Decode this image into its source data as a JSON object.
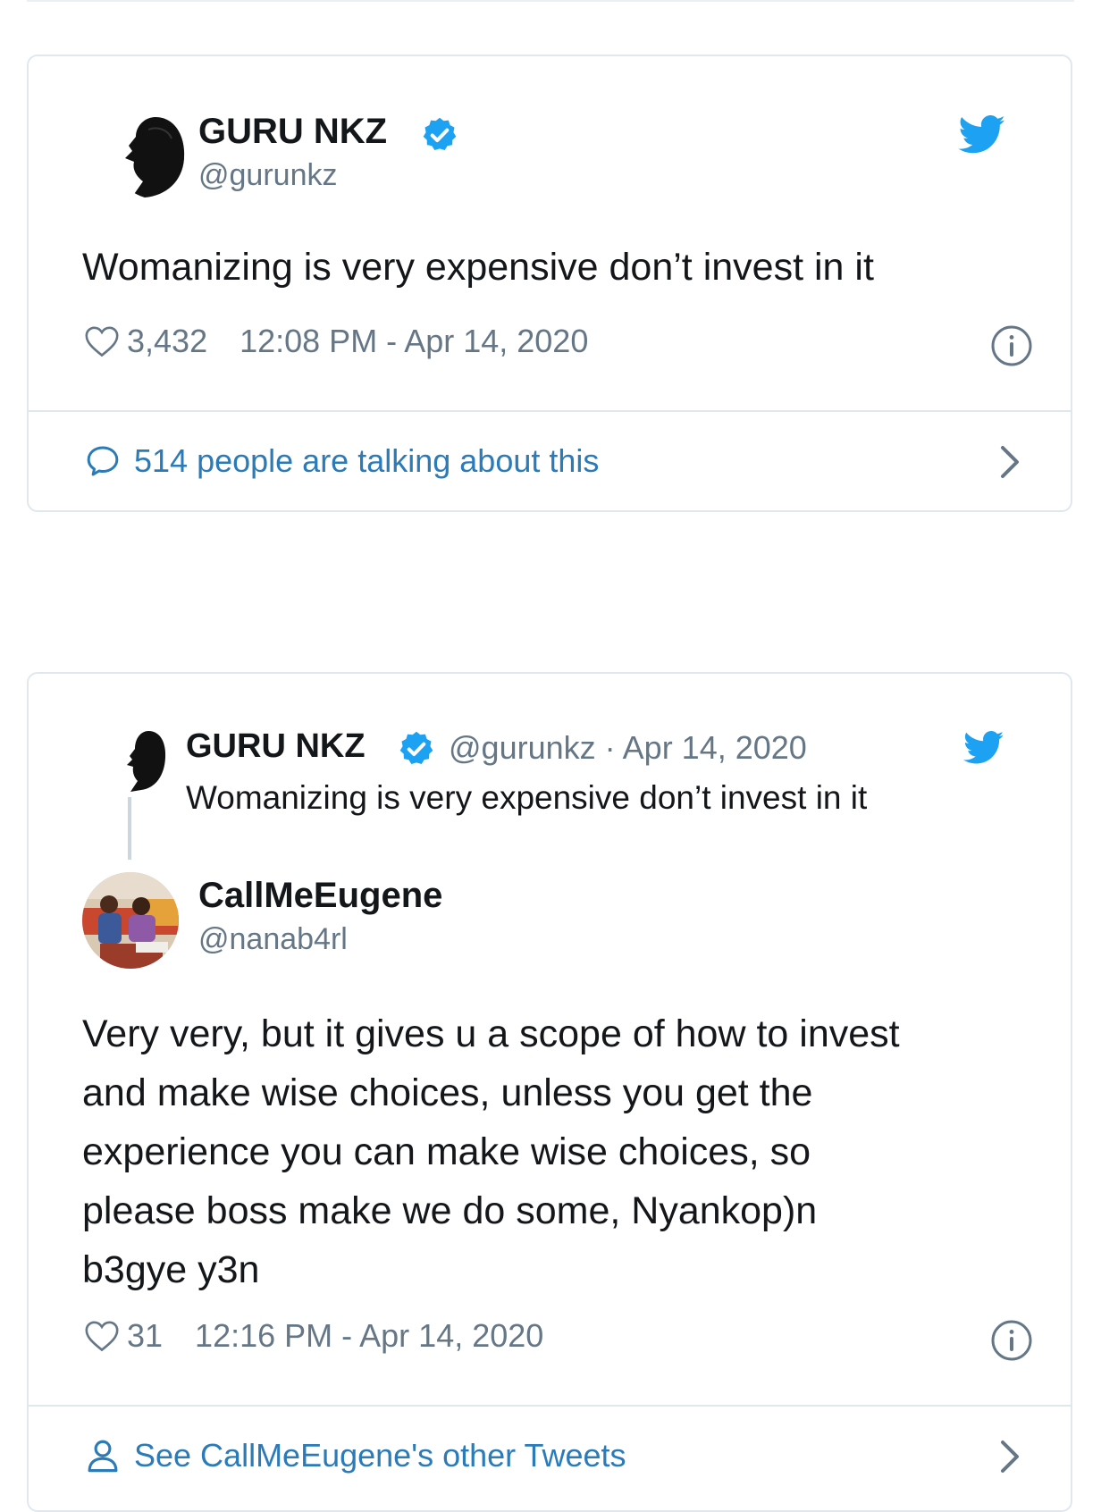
{
  "colors": {
    "verified": "#1da1f2",
    "link": "#2b7bb9",
    "muted": "#657786",
    "border": "#e1e8ed"
  },
  "tweet1": {
    "author_name": "GURU NKZ",
    "author_handle": "@gurunkz",
    "text": "Womanizing is very expensive don’t invest in it",
    "likes": "3,432",
    "timestamp": "12:08 PM - Apr 14, 2020",
    "footer_text": "514 people are talking about this",
    "footer_icon": "speech-bubble-icon"
  },
  "quoted": {
    "author_name": "GURU NKZ",
    "author_handle": "@gurunkz",
    "separator": "·",
    "date": "Apr 14, 2020",
    "text": "Womanizing is very expensive don’t invest in it"
  },
  "tweet2": {
    "author_name": "CallMeEugene",
    "author_handle": "@nanab4rl",
    "text_lines": [
      "Very very, but it gives u a scope of how to invest",
      "and make wise choices, unless you get the",
      "experience you can make wise choices, so",
      "please boss make we do some, Nyankop)n",
      "b3gye y3n"
    ],
    "likes": "31",
    "timestamp": "12:16 PM - Apr 14, 2020",
    "footer_text": "See CallMeEugene's other Tweets",
    "footer_icon": "person-icon"
  }
}
